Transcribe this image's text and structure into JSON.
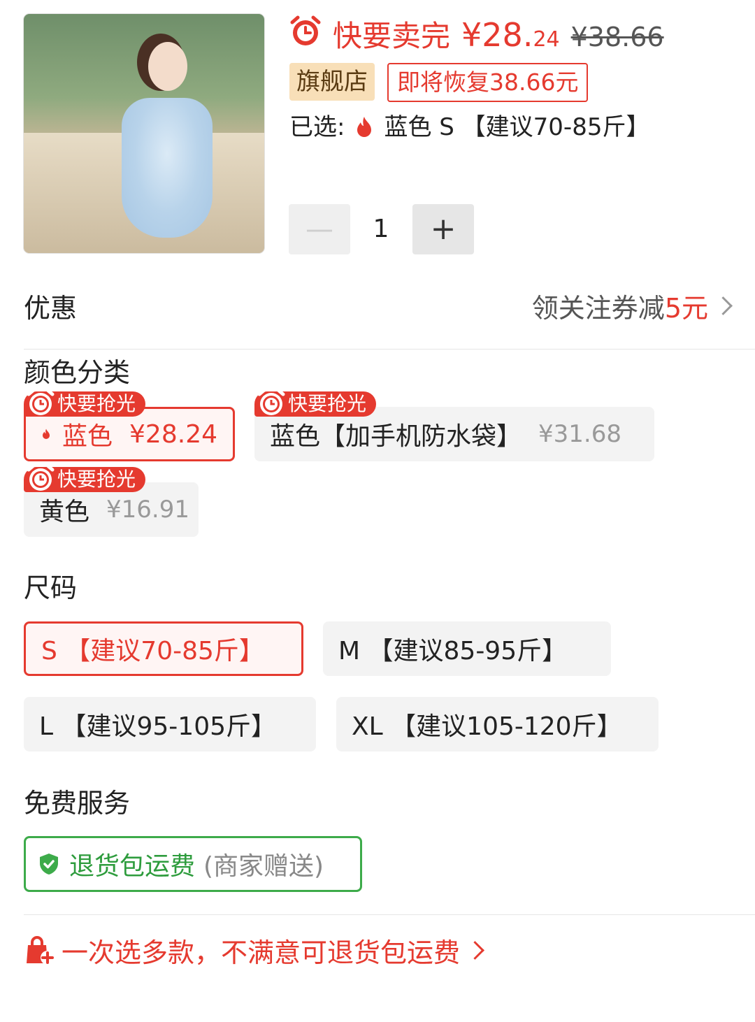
{
  "header": {
    "hot_label": "快要卖完",
    "price_main": "¥28.",
    "price_cents": "24",
    "price_original": "¥38.66",
    "store_tag": "旗舰店",
    "restore_tag": "即将恢复38.66元",
    "selected_prefix": "已选:",
    "selected_value": "蓝色 S 【建议70-85斤】",
    "quantity": "1",
    "minus_label": "—",
    "plus_label": "+"
  },
  "discount": {
    "title": "优惠",
    "coupon_text": "领关注券减",
    "coupon_amount": "5元"
  },
  "color": {
    "title": "颜色分类",
    "badge": "快要抢光",
    "options": [
      {
        "label": "蓝色",
        "price": "¥28.24",
        "selected": true
      },
      {
        "label": "蓝色【加手机防水袋】",
        "price": "¥31.68",
        "selected": false
      },
      {
        "label": "黄色",
        "price": "¥16.91",
        "selected": false
      }
    ]
  },
  "size": {
    "title": "尺码",
    "options": [
      {
        "label": "S 【建议70-85斤】",
        "selected": true
      },
      {
        "label": "M 【建议85-95斤】",
        "selected": false
      },
      {
        "label": "L 【建议95-105斤】",
        "selected": false
      },
      {
        "label": "XL 【建议105-120斤】",
        "selected": false
      }
    ]
  },
  "service": {
    "title": "免费服务",
    "name": "退货包运费",
    "note": "(商家赠送)"
  },
  "footer": {
    "text": "一次选多款，不满意可退货包运费"
  },
  "colors": {
    "accent": "#e53a2f",
    "green": "#3dab4a"
  }
}
